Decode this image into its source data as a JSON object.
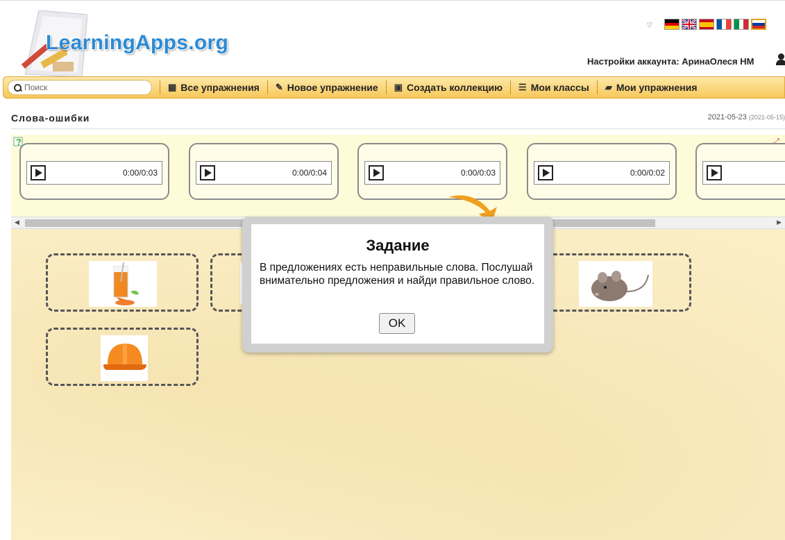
{
  "header": {
    "logo_text": "LearningApps.org",
    "account_label": "Настройки аккаунта: АринаОлеся НМ",
    "languages": [
      "de",
      "en",
      "es",
      "fr",
      "it",
      "ru"
    ]
  },
  "nav": {
    "search_placeholder": "Поиск",
    "items": [
      {
        "icon": "grid-icon",
        "label": "Все упражнения"
      },
      {
        "icon": "pencil-icon",
        "label": "Новое упражнение"
      },
      {
        "icon": "collection-icon",
        "label": "Создать коллекцию"
      },
      {
        "icon": "list-icon",
        "label": "Мои классы"
      },
      {
        "icon": "folder-icon",
        "label": "Мои упражнения"
      }
    ]
  },
  "page": {
    "title": "Слова-ошибки",
    "date": "2021-05-23",
    "date_created": "(2021-05-15)"
  },
  "audio_cards": [
    {
      "time": "0:00/0:03"
    },
    {
      "time": "0:00/0:04"
    },
    {
      "time": "0:00/0:03"
    },
    {
      "time": "0:00/0:02"
    },
    {
      "time": ""
    }
  ],
  "images": [
    "juice-image",
    "toy-image",
    "mouse-image",
    "helmet-image"
  ],
  "modal": {
    "title": "Задание",
    "text": "В предложениях есть неправильные слова. Послушай внимательно предложения и найди правильное слово.",
    "ok_label": "OK"
  },
  "colors": {
    "brand_blue": "#2a8ad6",
    "nav_orange": "#f7c85a",
    "app_bg": "#fbeec6",
    "strip_bg": "#fefbd8"
  }
}
